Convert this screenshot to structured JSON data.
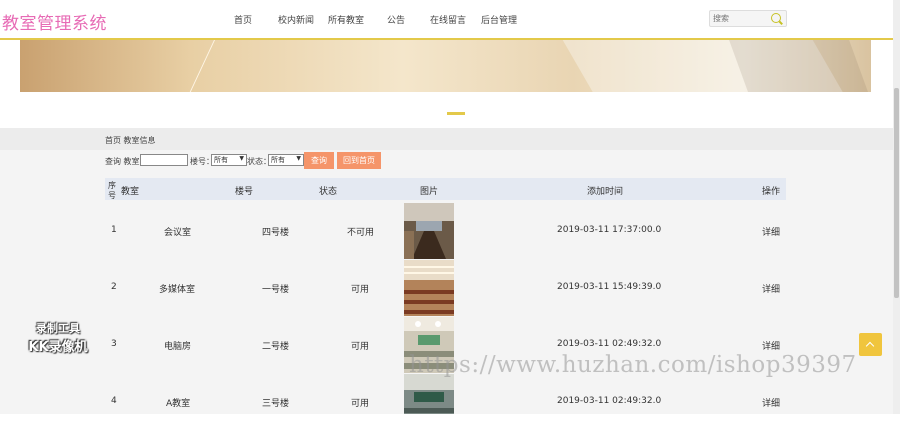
{
  "header": {
    "brand": "教室管理系统",
    "nav": [
      "首页",
      "校内新闻",
      "所有教室",
      "公告",
      "在线留言",
      "后台管理"
    ],
    "search_placeholder": "搜索"
  },
  "breadcrumb": "首页 教室信息",
  "filter": {
    "room_label": "查询 教室：",
    "building_label": "楼号：",
    "building_value": "所有",
    "status_label": "状态：",
    "status_value": "所有",
    "query_button": "查询",
    "reset_button": "回到首页"
  },
  "table": {
    "columns": [
      "序号",
      "教室",
      "楼号",
      "状态",
      "图片",
      "添加时间",
      "操作"
    ],
    "rows": [
      {
        "no": "1",
        "room": "会议室",
        "building": "四号楼",
        "status": "不可用",
        "time": "2019-03-11 17:37:00.0",
        "action": "详细"
      },
      {
        "no": "2",
        "room": "多媒体室",
        "building": "一号楼",
        "status": "可用",
        "time": "2019-03-11 15:49:39.0",
        "action": "详细"
      },
      {
        "no": "3",
        "room": "电脑房",
        "building": "二号楼",
        "status": "可用",
        "time": "2019-03-11 02:49:32.0",
        "action": "详细"
      },
      {
        "no": "4",
        "room": "A教室",
        "building": "三号楼",
        "status": "可用",
        "time": "2019-03-11 02:49:32.0",
        "action": "详细"
      }
    ]
  },
  "watermark": {
    "url": "https://www.huzhan.com/ishop39397",
    "logo_line1": "录制工具",
    "logo_line2": "KK录像机"
  },
  "colors": {
    "brand": "#e76bb5",
    "accent": "#e3c94a",
    "button": "#f5956a",
    "table_header": "#e4e9f2"
  }
}
